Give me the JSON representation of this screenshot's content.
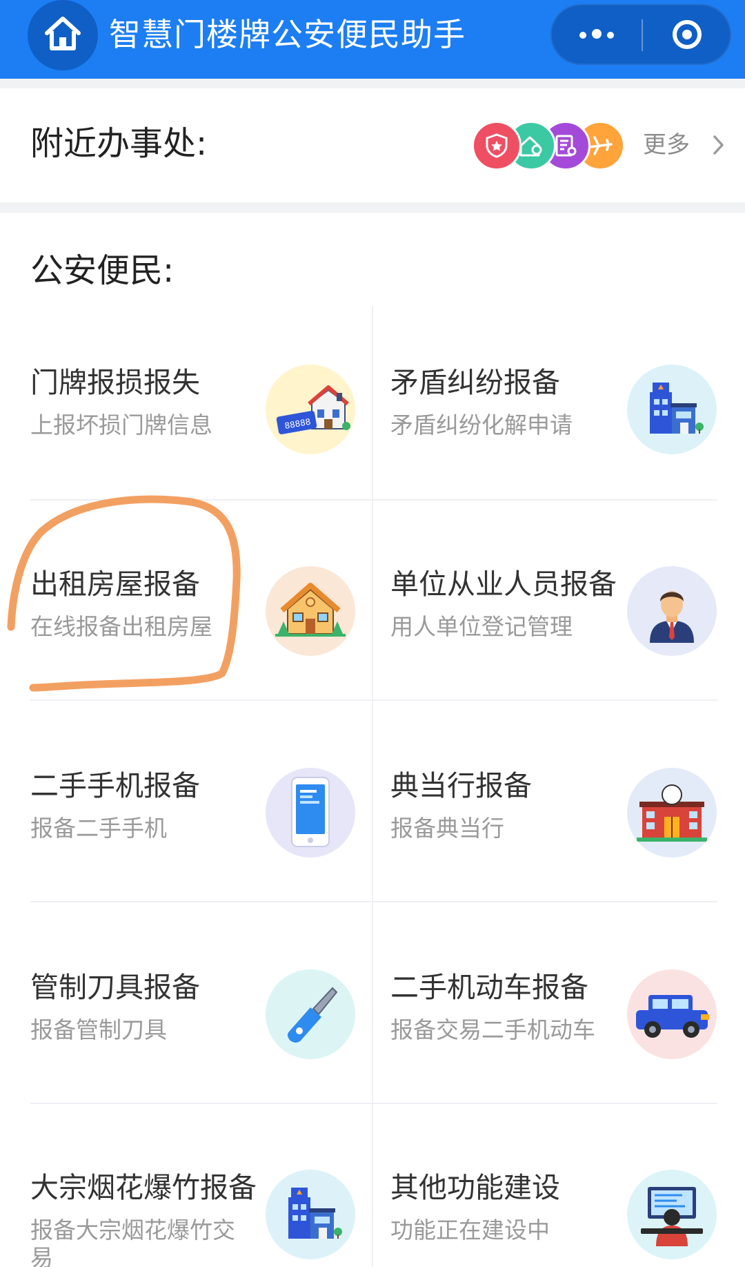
{
  "header": {
    "title": "智慧门楼牌公安便民助手",
    "icons": {
      "home": "home-icon",
      "more": "more-dots-icon",
      "close": "target-icon"
    },
    "color": "#1c7ef2"
  },
  "nearby": {
    "label": "附近办事处:",
    "more_label": "更多",
    "icons": [
      "police-shield-icon",
      "house-location-icon",
      "document-icon",
      "airplane-icon"
    ],
    "icon_colors": [
      "#ef4f63",
      "#3bc9a3",
      "#a44ad8",
      "#ffa43b"
    ]
  },
  "services": {
    "label": "公安便民:",
    "items": [
      {
        "title": "门牌报损报失",
        "subtitle": "上报坏损门牌信息",
        "icon": "house-number-plate-icon",
        "bg": "#fff4cc"
      },
      {
        "title": "矛盾纠纷报备",
        "subtitle": "矛盾纠纷化解申请",
        "icon": "police-station-icon",
        "bg": "#dcf2f8"
      },
      {
        "title": "出租房屋报备",
        "subtitle": "在线报备出租房屋",
        "icon": "rental-house-icon",
        "bg": "#fbe7d6"
      },
      {
        "title": "单位从业人员报备",
        "subtitle": "用人单位登记管理",
        "icon": "employee-icon",
        "bg": "#e5e9f8"
      },
      {
        "title": "二手手机报备",
        "subtitle": "报备二手手机",
        "icon": "mobile-phone-icon",
        "bg": "#e6e6f8"
      },
      {
        "title": "典当行报备",
        "subtitle": "报备典当行",
        "icon": "pawnshop-building-icon",
        "bg": "#e3ebf8"
      },
      {
        "title": "管制刀具报备",
        "subtitle": "报备管制刀具",
        "icon": "knife-icon",
        "bg": "#dcf4f4"
      },
      {
        "title": "二手机动车报备",
        "subtitle": "报备交易二手机动车",
        "icon": "jeep-car-icon",
        "bg": "#fbe2e2"
      },
      {
        "title": "大宗烟花爆竹报备",
        "subtitle": "报备大宗烟花爆竹交易",
        "icon": "police-station-icon",
        "bg": "#dcf2f8"
      },
      {
        "title": "其他功能建设",
        "subtitle": "功能正在建设中",
        "icon": "computer-worker-icon",
        "bg": "#dcf4f8"
      }
    ]
  }
}
